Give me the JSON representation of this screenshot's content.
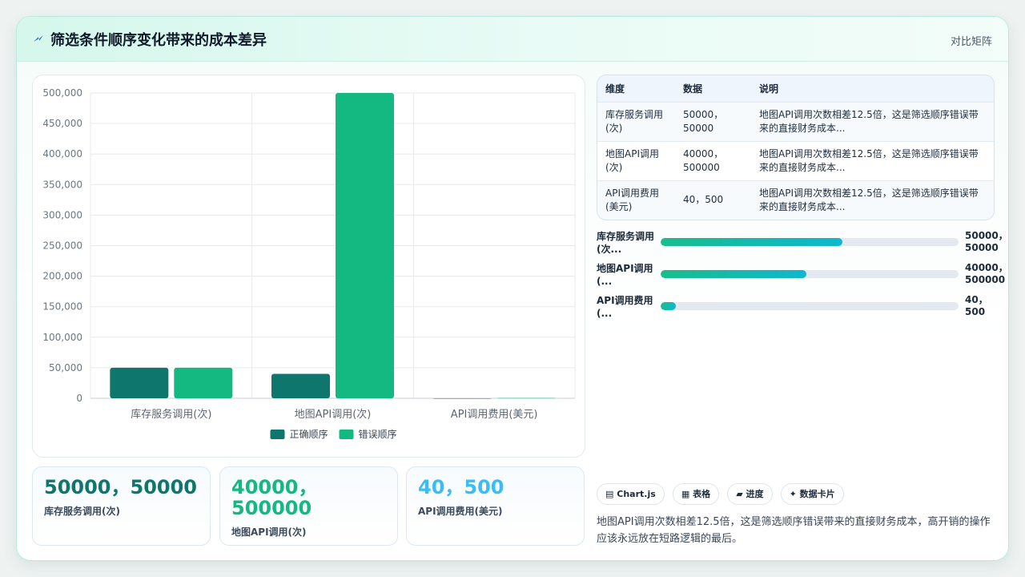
{
  "header": {
    "title": "筛选条件顺序变化带来的成本差异",
    "tag": "对比矩阵"
  },
  "chart_data": {
    "type": "bar",
    "categories": [
      "库存服务调用(次)",
      "地图API调用(次)",
      "API调用费用(美元)"
    ],
    "series": [
      {
        "name": "正确顺序",
        "color": "#0f766e",
        "values": [
          50000,
          40000,
          40
        ]
      },
      {
        "name": "错误顺序",
        "color": "#13b981",
        "values": [
          50000,
          500000,
          500
        ]
      }
    ],
    "ylim": [
      0,
      500000
    ],
    "yticks": [
      "0",
      "50,000",
      "100,000",
      "150,000",
      "200,000",
      "250,000",
      "300,000",
      "350,000",
      "400,000",
      "450,000",
      "500,000"
    ],
    "legend": "bottom"
  },
  "table": {
    "headers": [
      "维度",
      "数据",
      "说明"
    ],
    "rows": [
      {
        "dim": "库存服务调用(次)",
        "data": "50000，50000",
        "note": "地图API调用次数相差12.5倍，这是筛选顺序错误带来的直接财务成本..."
      },
      {
        "dim": "地图API调用(次)",
        "data": "40000，500000",
        "note": "地图API调用次数相差12.5倍，这是筛选顺序错误带来的直接财务成本..."
      },
      {
        "dim": "API调用费用(美元)",
        "data": "40，500",
        "note": "地图API调用次数相差12.5倍，这是筛选顺序错误带来的直接财务成本..."
      }
    ]
  },
  "progress": [
    {
      "label": "库存服务调用(次...",
      "value": "50000，50000",
      "fraction": 0.61
    },
    {
      "label": "地图API调用(...",
      "value": "40000，500000",
      "fraction": 0.49
    },
    {
      "label": "API调用费用(...",
      "value": "40，500",
      "fraction": 0.05
    }
  ],
  "kpis": [
    {
      "value": "50000，50000",
      "label": "库存服务调用(次)",
      "color": "#0f766e"
    },
    {
      "value": "40000，500000",
      "label": "地图API调用(次)",
      "color": "#13b981"
    },
    {
      "value": "40，500",
      "label": "API调用费用(美元)",
      "color": "#38bdf8"
    }
  ],
  "chips": [
    {
      "icon": "▤",
      "label": "Chart.js"
    },
    {
      "icon": "▦",
      "label": "表格"
    },
    {
      "icon": "▰",
      "label": "进度"
    },
    {
      "icon": "✦",
      "label": "数据卡片"
    }
  ],
  "summary": "地图API调用次数相差12.5倍，这是筛选顺序错误带来的直接财务成本，高开销的操作应该永远放在短路逻辑的最后。"
}
